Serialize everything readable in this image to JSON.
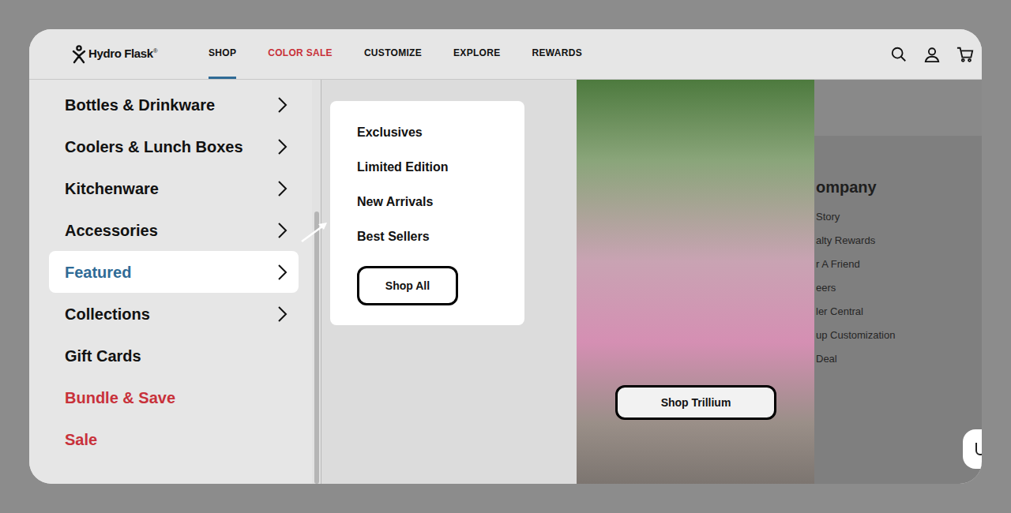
{
  "logo": {
    "text": "Hydro Flask",
    "mark": "®"
  },
  "nav": [
    {
      "label": "SHOP",
      "selected": true,
      "sale": false
    },
    {
      "label": "COLOR SALE",
      "selected": false,
      "sale": true
    },
    {
      "label": "CUSTOMIZE",
      "selected": false,
      "sale": false
    },
    {
      "label": "EXPLORE",
      "selected": false,
      "sale": false
    },
    {
      "label": "REWARDS",
      "selected": false,
      "sale": false
    }
  ],
  "menu": [
    {
      "label": "Bottles & Drinkware",
      "expandable": true,
      "selected": false,
      "sale": false
    },
    {
      "label": "Coolers & Lunch Boxes",
      "expandable": true,
      "selected": false,
      "sale": false
    },
    {
      "label": "Kitchenware",
      "expandable": true,
      "selected": false,
      "sale": false
    },
    {
      "label": "Accessories",
      "expandable": true,
      "selected": false,
      "sale": false
    },
    {
      "label": "Featured",
      "expandable": true,
      "selected": true,
      "sale": false
    },
    {
      "label": "Collections",
      "expandable": true,
      "selected": false,
      "sale": false
    },
    {
      "label": "Gift Cards",
      "expandable": false,
      "selected": false,
      "sale": false
    },
    {
      "label": "Bundle & Save",
      "expandable": false,
      "selected": false,
      "sale": true
    },
    {
      "label": "Sale",
      "expandable": false,
      "selected": false,
      "sale": true
    }
  ],
  "submenu": {
    "links": [
      "Exclusives",
      "Limited Edition",
      "New Arrivals",
      "Best Sellers"
    ],
    "button": "Shop All"
  },
  "promo": {
    "button": "Shop Trillium"
  },
  "footer": {
    "heading": "ompany",
    "links": [
      "Story",
      "alty Rewards",
      "r A Friend",
      "eers",
      "ler Central",
      "up Customization",
      "Deal"
    ]
  }
}
